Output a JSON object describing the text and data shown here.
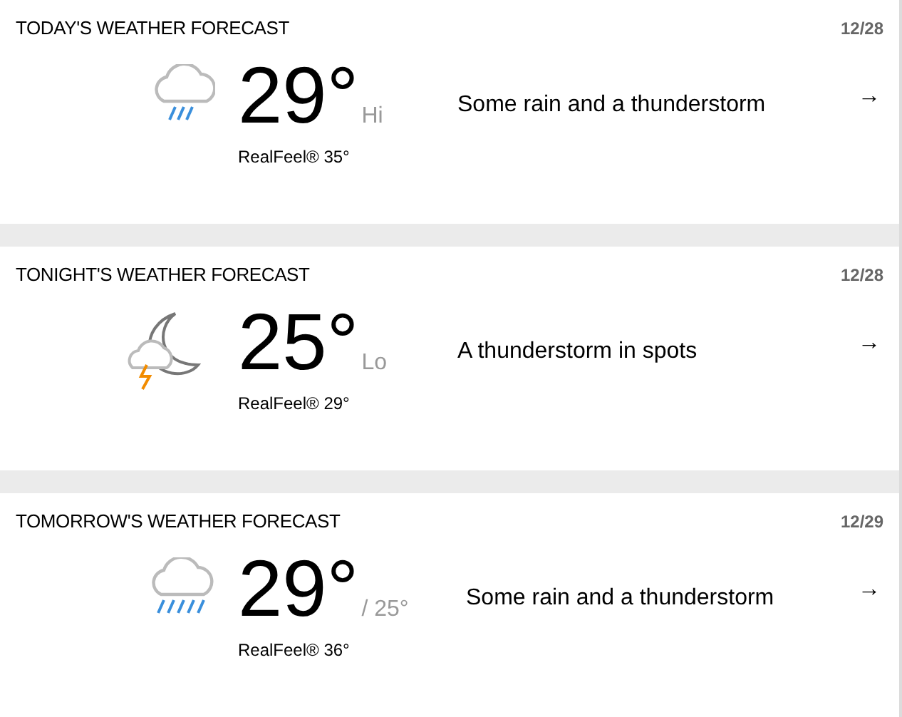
{
  "cards": [
    {
      "title": "TODAY'S WEATHER FORECAST",
      "date": "12/28",
      "kind": "rain",
      "temp": "29°",
      "suffix": "Hi",
      "realfeel": "RealFeel® 35°",
      "phrase": "Some rain and a thunderstorm",
      "arrow": "→"
    },
    {
      "title": "TONIGHT'S WEATHER FORECAST",
      "date": "12/28",
      "kind": "night-storm",
      "temp": "25°",
      "suffix": "Lo",
      "realfeel": "RealFeel® 29°",
      "phrase": "A thunderstorm in spots",
      "arrow": "→"
    },
    {
      "title": "TOMORROW'S WEATHER FORECAST",
      "date": "12/29",
      "kind": "heavy-rain",
      "temp": "29°",
      "suffix": "/ 25°",
      "realfeel": "RealFeel® 36°",
      "phrase": "Some rain and a thunderstorm",
      "arrow": "→"
    }
  ]
}
